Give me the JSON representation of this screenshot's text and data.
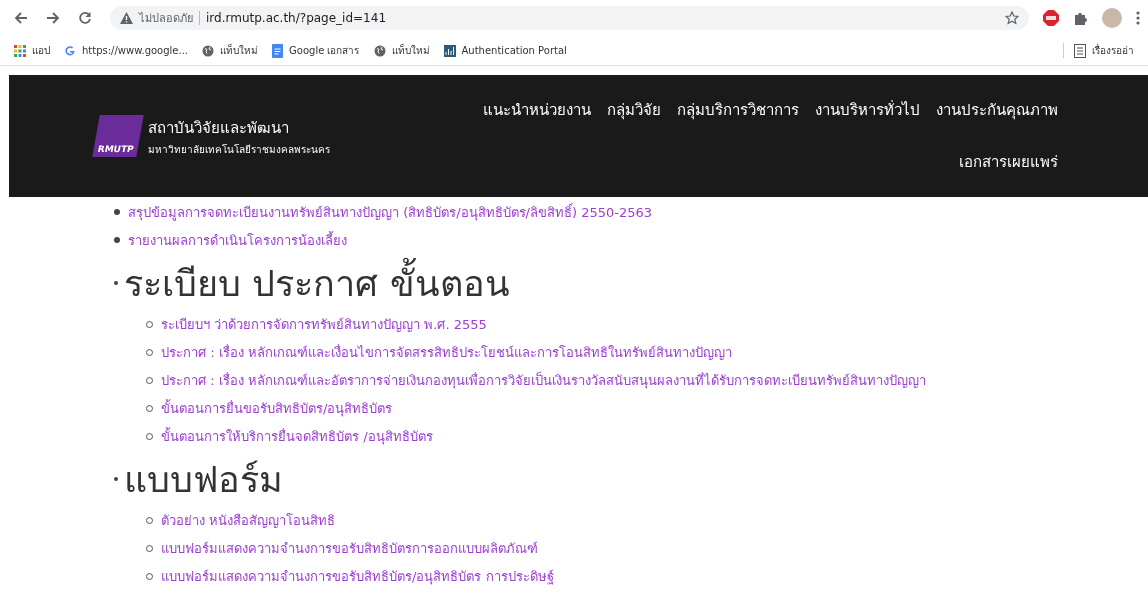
{
  "browser": {
    "security_label": "ไม่ปลอดภัย",
    "url": "ird.rmutp.ac.th/?page_id=141",
    "bookmarks": [
      {
        "kind": "apps",
        "label": "แอป"
      },
      {
        "kind": "google",
        "label": "https://www.google..."
      },
      {
        "kind": "globe",
        "label": "แท็บใหม่"
      },
      {
        "kind": "docs",
        "label": "Google เอกสาร"
      },
      {
        "kind": "globe",
        "label": "แท็บใหม่"
      },
      {
        "kind": "portal",
        "label": "Authentication Portal"
      }
    ],
    "reading_list": "เรื่องรออ่า"
  },
  "site_header": {
    "logo_mark": "RMUTP",
    "org_name": "สถาบันวิจัยและพัฒนา",
    "university": "มหาวิทยาลัยเทคโนโลยีราชมงคลพระนคร",
    "nav": [
      "แนะนำหน่วยงาน",
      "กลุ่มวิจัย",
      "กลุ่มบริการวิชาการ",
      "งานบริหารทั่วไป",
      "งานประกันคุณภาพ",
      "เอกสารเผยแพร่"
    ]
  },
  "top_links": [
    "สรุปข้อมูลการจดทะเบียนงานทรัพย์สินทางปัญญา (สิทธิบัตร/อนุสิทธิบัตร/ลิขสิทธิ์) 2550-2563",
    "รายงานผลการดำเนินโครงการน้องเลี้ยง"
  ],
  "sections": [
    {
      "heading": "ระเบียบ ประกาศ ขั้นตอน",
      "items": [
        {
          "kind": "sub",
          "text": "ระเบียบฯ ว่าด้วยการจัดการทรัพย์สินทางปัญญา พ.ศ. 2555"
        },
        {
          "kind": "sub",
          "text": "ประกาศ : เรื่อง หลักเกณฑ์และเงื่อนไขการจัดสรรสิทธิประโยชน์และการโอนสิทธิในทรัพย์สินทางปัญญา"
        },
        {
          "kind": "sub",
          "text": "ประกาศ : เรื่อง หลักเกณฑ์และอัตราการจ่ายเงินกองทุนเพื่อการวิจัยเป็นเงินรางวัลสนับสนุนผลงานที่ได้รับการจดทะเบียนทรัพย์สินทางปัญญา"
        },
        {
          "kind": "sub",
          "text": "ขั้นตอนการยื่นขอรับสิทธิบัตร/อนุสิทธิบัตร"
        },
        {
          "kind": "sub",
          "text": "ขั้นตอนการให้บริการยื่นจดสิทธิบัตร /อนุสิทธิบัตร"
        }
      ]
    },
    {
      "heading": "แบบฟอร์ม",
      "items": [
        {
          "kind": "sub",
          "text": "ตัวอย่าง หนังสือสัญญาโอนสิทธิ"
        },
        {
          "kind": "sub",
          "text": "แบบฟอร์มแสดงความจำนงการขอรับสิทธิบัตรการออกแบบผลิตภัณฑ์"
        },
        {
          "kind": "sub",
          "text": "แบบฟอร์มแสดงความจำนงการขอรับสิทธิบัตร/อนุสิทธิบัตร การประดิษฐ์"
        }
      ]
    }
  ]
}
